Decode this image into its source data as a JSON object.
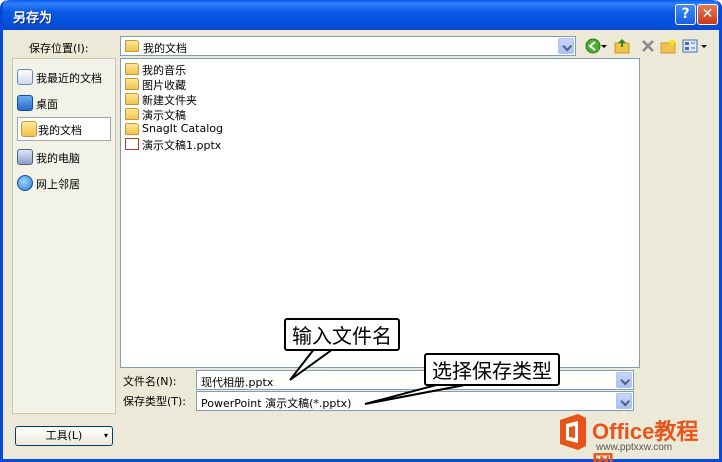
{
  "window": {
    "title": "另存为"
  },
  "titlebar": {
    "help_glyph": "?",
    "close_glyph": "✕"
  },
  "location": {
    "label": "保存位置(I):",
    "value": "我的文档"
  },
  "places": [
    {
      "label": "我最近的文档",
      "icon": "recent-docs-icon"
    },
    {
      "label": "桌面",
      "icon": "desktop-icon"
    },
    {
      "label": "我的文档",
      "icon": "my-documents-icon",
      "selected": true
    },
    {
      "label": "我的电脑",
      "icon": "my-computer-icon"
    },
    {
      "label": "网上邻居",
      "icon": "network-places-icon"
    }
  ],
  "files": [
    {
      "name": "我的音乐",
      "type": "music-folder"
    },
    {
      "name": "图片收藏",
      "type": "pictures-folder"
    },
    {
      "name": "新建文件夹",
      "type": "folder"
    },
    {
      "name": "演示文稿",
      "type": "folder"
    },
    {
      "name": "SnagIt Catalog",
      "type": "folder"
    },
    {
      "name": "演示文稿1.pptx",
      "type": "pptx-file"
    }
  ],
  "filename": {
    "label": "文件名(N):",
    "value": "现代相册.pptx"
  },
  "filetype": {
    "label": "保存类型(T):",
    "value": "PowerPoint 演示文稿(*.pptx)"
  },
  "buttons": {
    "tools": "工具(L)"
  },
  "annotations": {
    "filename_callout": "输入文件名",
    "filetype_callout": "选择保存类型"
  },
  "watermark": {
    "text": "Office教程网",
    "url": "www.pptxxw.com"
  },
  "colors": {
    "titlebar": "#0a58e8",
    "dialog_bg": "#ece9d8",
    "input_border": "#7f9db9"
  }
}
